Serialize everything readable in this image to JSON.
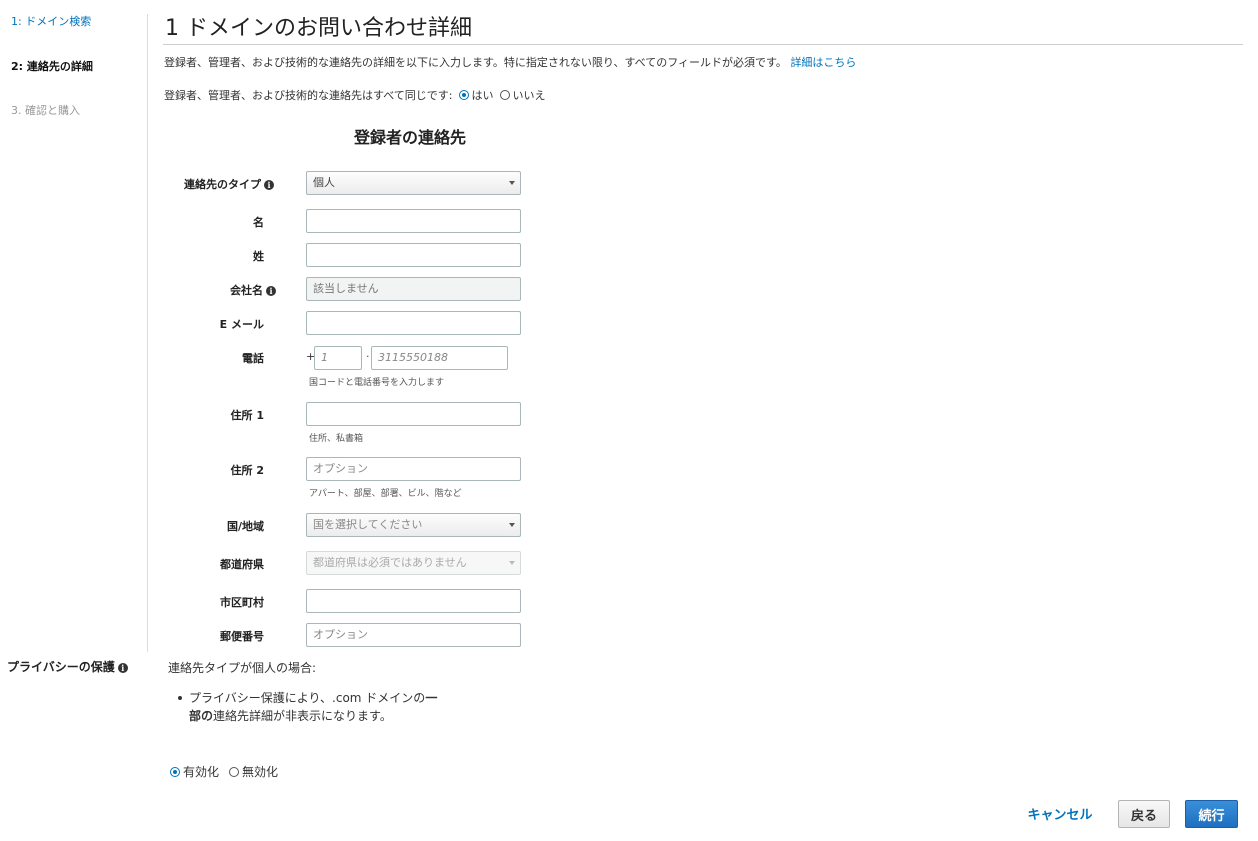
{
  "sidebar": {
    "steps": [
      {
        "label": "1: ドメイン検索"
      },
      {
        "label": "2: 連絡先の詳細"
      },
      {
        "label": "3. 確認と購入"
      }
    ]
  },
  "header": {
    "title": "1 ドメインのお問い合わせ詳細",
    "intro": "登録者、管理者、および技術的な連絡先の詳細を以下に入力します。特に指定されない限り、すべてのフィールドが必須です。",
    "intro_link": "詳細はこちら",
    "same_contacts_question": "登録者、管理者、および技術的な連絡先はすべて同じです:",
    "same_yes": "はい",
    "same_no": "いいえ"
  },
  "form": {
    "section_title": "登録者の連絡先",
    "contact_type": {
      "label": "連絡先のタイプ",
      "value": "個人"
    },
    "first_name": {
      "label": "名",
      "value": ""
    },
    "last_name": {
      "label": "姓",
      "value": ""
    },
    "company": {
      "label": "会社名",
      "placeholder": "該当しません"
    },
    "email": {
      "label": "E メール",
      "value": ""
    },
    "phone": {
      "label": "電話",
      "plus": "+",
      "country_code_placeholder": "1",
      "separator": "·",
      "number_placeholder": "3115550188",
      "hint": "国コードと電話番号を入力します"
    },
    "address1": {
      "label": "住所 1",
      "value": "",
      "hint": "住所、私書箱"
    },
    "address2": {
      "label": "住所 2",
      "placeholder": "オプション",
      "hint": "アパート、部屋、部署、ビル、階など"
    },
    "country": {
      "label": "国/地域",
      "placeholder": "国を選択してください"
    },
    "state": {
      "label": "都道府県",
      "placeholder": "都道府県は必須ではありません"
    },
    "city": {
      "label": "市区町村",
      "value": ""
    },
    "postal": {
      "label": "郵便番号",
      "placeholder": "オプション"
    }
  },
  "privacy": {
    "label": "プライバシーの保護",
    "condition": "連絡先タイプが個人の場合:",
    "bullet_part1": "プライバシー保護により、.com ドメインの",
    "bullet_bold": "一部の",
    "bullet_part2": "連絡先詳細が非表示になります。",
    "enabled": "有効化",
    "disabled": "無効化"
  },
  "buttons": {
    "cancel": "キャンセル",
    "back": "戻る",
    "continue": "続行"
  },
  "colors": {
    "link": "#0073bb",
    "primary": "#1e6fc0"
  }
}
